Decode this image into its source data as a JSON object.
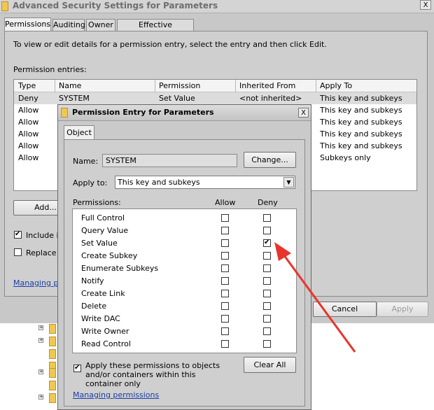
{
  "outer": {
    "title": "Advanced Security Settings for Parameters",
    "close_glyph": "X",
    "tabs": [
      "Permissions",
      "Auditing",
      "Owner",
      "Effective Permissions"
    ],
    "instruction": "To view or edit details for a permission entry, select the entry and then click Edit.",
    "entries_label": "Permission entries:",
    "columns": [
      "Type",
      "Name",
      "Permission",
      "Inherited From",
      "Apply To"
    ],
    "first_row": {
      "type": "Deny",
      "name": "SYSTEM",
      "permission": "Set Value",
      "inherited": "<not inherited>",
      "apply": "This key and subkeys"
    },
    "other_types": [
      "Allow",
      "Allow",
      "Allow",
      "Allow",
      "Allow"
    ],
    "other_apply": [
      "This key and subkeys",
      "This key and subkeys",
      "This key and subkeys",
      "This key and subkeys",
      "Subkeys only"
    ],
    "add_button": "Add...",
    "include_label": "Include in",
    "replace_label": "Replace",
    "managing_link": "Managing pe",
    "cancel_button": "Cancel",
    "apply_button": "Apply"
  },
  "dialog": {
    "title": "Permission Entry for Parameters",
    "close_glyph": "X",
    "tab": "Object",
    "name_label": "Name:",
    "name_value": "SYSTEM",
    "change_button": "Change...",
    "apply_to_label": "Apply to:",
    "apply_to_value": "This key and subkeys",
    "permissions_label": "Permissions:",
    "allow_header": "Allow",
    "deny_header": "Deny",
    "permissions": [
      {
        "name": "Full Control",
        "allow": false,
        "deny": false
      },
      {
        "name": "Query Value",
        "allow": false,
        "deny": false
      },
      {
        "name": "Set Value",
        "allow": false,
        "deny": true
      },
      {
        "name": "Create Subkey",
        "allow": false,
        "deny": false
      },
      {
        "name": "Enumerate Subkeys",
        "allow": false,
        "deny": false
      },
      {
        "name": "Notify",
        "allow": false,
        "deny": false
      },
      {
        "name": "Create Link",
        "allow": false,
        "deny": false
      },
      {
        "name": "Delete",
        "allow": false,
        "deny": false
      },
      {
        "name": "Write DAC",
        "allow": false,
        "deny": false
      },
      {
        "name": "Write Owner",
        "allow": false,
        "deny": false
      },
      {
        "name": "Read Control",
        "allow": false,
        "deny": false
      }
    ],
    "apply_children_label": "Apply these permissions to objects and/or containers within this container only",
    "apply_children_checked": true,
    "clear_all_button": "Clear All",
    "managing_link": "Managing permissions"
  },
  "colors": {
    "annotation_arrow": "#e8352c",
    "link": "#1a3ea8",
    "selected_row": "#dcdcdc"
  }
}
